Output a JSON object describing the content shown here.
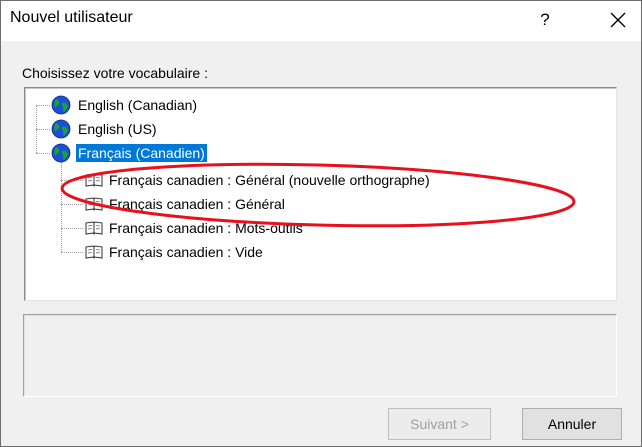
{
  "window": {
    "title": "Nouvel utilisateur",
    "help_symbol": "?",
    "close_symbol": "X"
  },
  "prompt": "Choisissez votre vocabulaire :",
  "tree": {
    "languages": [
      {
        "label": "English (Canadian)",
        "icon": "globe-icon",
        "selected": false
      },
      {
        "label": "English (US)",
        "icon": "globe-icon",
        "selected": false
      },
      {
        "label": "Français (Canadien)",
        "icon": "globe-icon",
        "selected": true
      }
    ],
    "vocabularies": [
      {
        "label": "Français canadien : Général (nouvelle orthographe)",
        "icon": "book-icon"
      },
      {
        "label": "Français canadien : Général",
        "icon": "book-icon"
      },
      {
        "label": "Français canadien : Mots-outils",
        "icon": "book-icon"
      },
      {
        "label": "Français canadien : Vide",
        "icon": "book-icon"
      }
    ]
  },
  "buttons": {
    "next": "Suivant >",
    "cancel": "Annuler"
  },
  "colors": {
    "selection": "#0078d7",
    "annotation": "#e8101c"
  }
}
